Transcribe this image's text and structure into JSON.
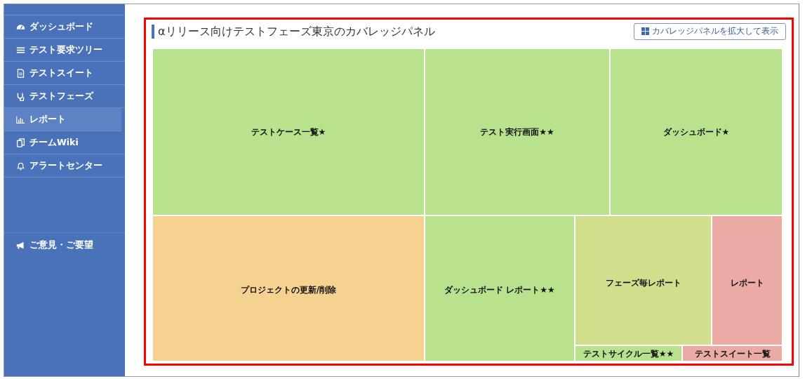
{
  "sidebar": {
    "items": [
      {
        "label": "ダッシュボード",
        "selected": false
      },
      {
        "label": "テスト要求ツリー",
        "selected": false
      },
      {
        "label": "テストスイート",
        "selected": false
      },
      {
        "label": "テストフェーズ",
        "selected": false
      },
      {
        "label": "レポート",
        "selected": true
      },
      {
        "label": "チームWiki",
        "selected": false
      },
      {
        "label": "アラートセンター",
        "selected": false
      }
    ],
    "feedback": {
      "label": "ご意見・ご要望"
    }
  },
  "panel": {
    "title": "αリリース向けテストフェーズ東京のカバレッジパネル",
    "expand_button": "カバレッジパネルを拡大して表示",
    "tiles": [
      {
        "label": "テストケース一覧★",
        "color": "#b8e28e"
      },
      {
        "label": "テスト実行画面★★",
        "color": "#b8e28e"
      },
      {
        "label": "ダッシュボード★",
        "color": "#b8e28e"
      },
      {
        "label": "プロジェクトの更新/削除",
        "color": "#f5d290"
      },
      {
        "label": "ダッシュボード レポート★★",
        "color": "#b8e28e"
      },
      {
        "label": "フェーズ毎レポート",
        "color": "#d1de8c"
      },
      {
        "label": "レポート",
        "color": "#ebaaa3"
      },
      {
        "label": "テストサイクル一覧★★",
        "color": "#b8e28e"
      },
      {
        "label": "テストスイート一覧",
        "color": "#ebaaa3"
      }
    ]
  }
}
